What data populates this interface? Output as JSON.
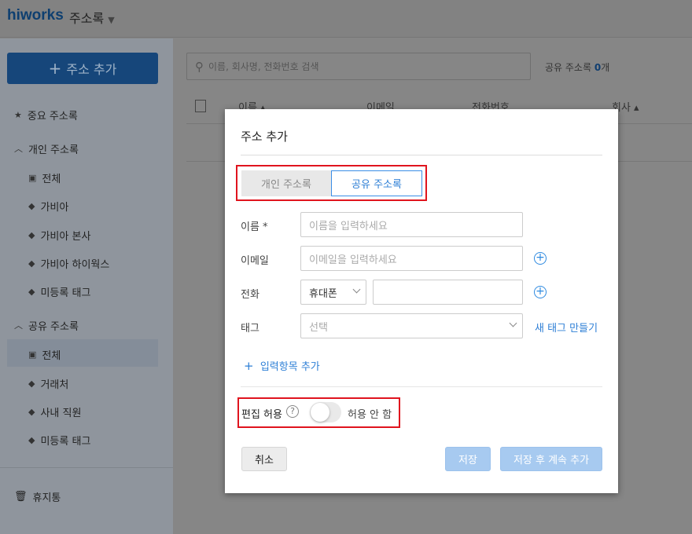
{
  "header": {
    "logo": "hiworks",
    "app": "주소록"
  },
  "sidebar": {
    "add_button": "주소 추가",
    "items": [
      {
        "label": "중요 주소록",
        "icon": "star-icon"
      },
      {
        "label": "개인 주소록",
        "icon": "chevron-up-icon"
      },
      {
        "label": "전체",
        "icon": "contact-icon"
      },
      {
        "label": "가비아",
        "icon": "tag-icon"
      },
      {
        "label": "가비아 본사",
        "icon": "tag-icon"
      },
      {
        "label": "가비아 하이웍스",
        "icon": "tag-icon"
      },
      {
        "label": "미등록 태그",
        "icon": "tag-icon"
      },
      {
        "label": "공유 주소록",
        "icon": "chevron-up-icon"
      },
      {
        "label": "전체",
        "icon": "contact-icon"
      },
      {
        "label": "거래처",
        "icon": "tag-icon"
      },
      {
        "label": "사내 직원",
        "icon": "tag-icon"
      },
      {
        "label": "미등록 태그",
        "icon": "tag-icon"
      }
    ],
    "trash": "휴지통"
  },
  "main": {
    "search_placeholder": "이름, 회사명, 전화번호 검색",
    "count_label": "공유 주소록",
    "count": "0",
    "count_unit": "개",
    "columns": [
      "이름",
      "이메일",
      "전화번호",
      "회사"
    ]
  },
  "modal": {
    "title": "주소 추가",
    "tabs": [
      "개인 주소록",
      "공유 주소록"
    ],
    "name_label": "이름 *",
    "name_placeholder": "이름을 입력하세요",
    "email_label": "이메일",
    "email_placeholder": "이메일을 입력하세요",
    "phone_label": "전화",
    "phone_type": "휴대폰",
    "tag_label": "태그",
    "tag_placeholder": "선택",
    "new_tag": "새 태그 만들기",
    "add_field": "입력항목 추가",
    "edit_label": "편집 허용",
    "edit_state": "허용 안 함",
    "edit_allowed": false,
    "cancel": "취소",
    "save": "저장",
    "save_continue": "저장 후 계속 추가"
  }
}
